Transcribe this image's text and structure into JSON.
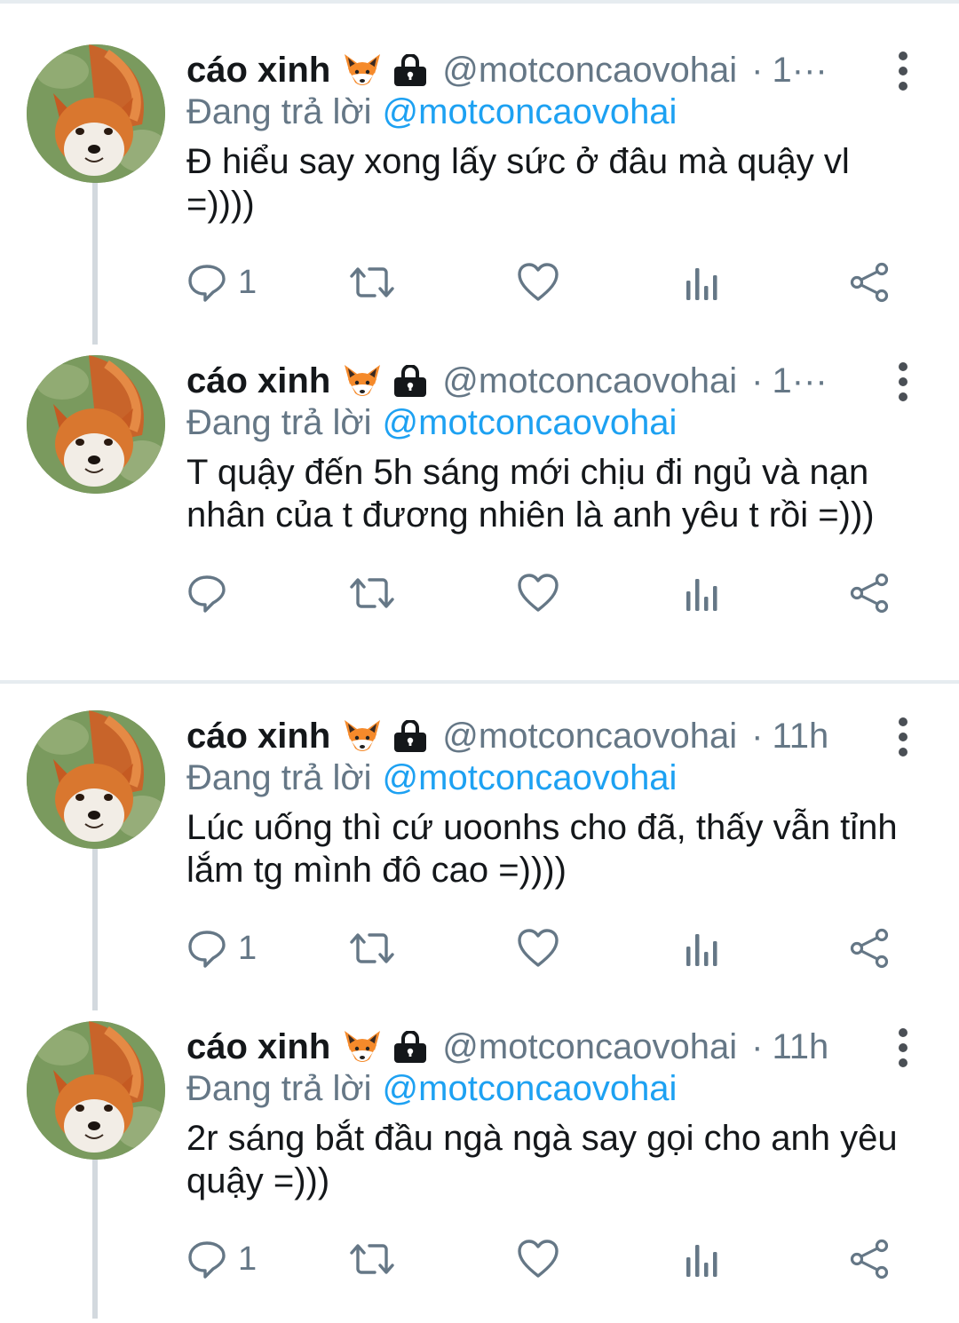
{
  "colors": {
    "text": "#14171a",
    "secondary": "#657786",
    "accent": "#1da1f2",
    "divider": "#e6ecf0",
    "thread_line": "#d3d9de"
  },
  "tweets": [
    {
      "display_name": "cáo xinh",
      "emoji": "fox-face",
      "protected_icon": "lock-icon",
      "handle": "@motconcaovohai",
      "dot": "·",
      "time": "1···",
      "reply_prefix": "Đang trả lời",
      "reply_to": "@motconcaovohai",
      "text": "Đ hiểu say xong lấy sức ở đâu mà quậy vl =))))",
      "reply_count": "1"
    },
    {
      "display_name": "cáo xinh",
      "emoji": "fox-face",
      "protected_icon": "lock-icon",
      "handle": "@motconcaovohai",
      "dot": "·",
      "time": "1···",
      "reply_prefix": "Đang trả lời",
      "reply_to": "@motconcaovohai",
      "text": "T quậy đến 5h sáng mới chịu đi ngủ và nạn nhân của t đương nhiên là anh yêu t rồi =)))",
      "reply_count": ""
    },
    {
      "display_name": "cáo xinh",
      "emoji": "fox-face",
      "protected_icon": "lock-icon",
      "handle": "@motconcaovohai",
      "dot": "·",
      "time": "11h",
      "reply_prefix": "Đang trả lời",
      "reply_to": "@motconcaovohai",
      "text": "Lúc uống thì cứ uoonhs cho đã, thấy vẫn tỉnh lắm tg mình đô cao =))))",
      "reply_count": "1"
    },
    {
      "display_name": "cáo xinh",
      "emoji": "fox-face",
      "protected_icon": "lock-icon",
      "handle": "@motconcaovohai",
      "dot": "·",
      "time": "11h",
      "reply_prefix": "Đang trả lời",
      "reply_to": "@motconcaovohai",
      "text": "2r sáng bắt đầu ngà ngà say gọi cho anh yêu quậy =)))",
      "reply_count": "1"
    }
  ]
}
